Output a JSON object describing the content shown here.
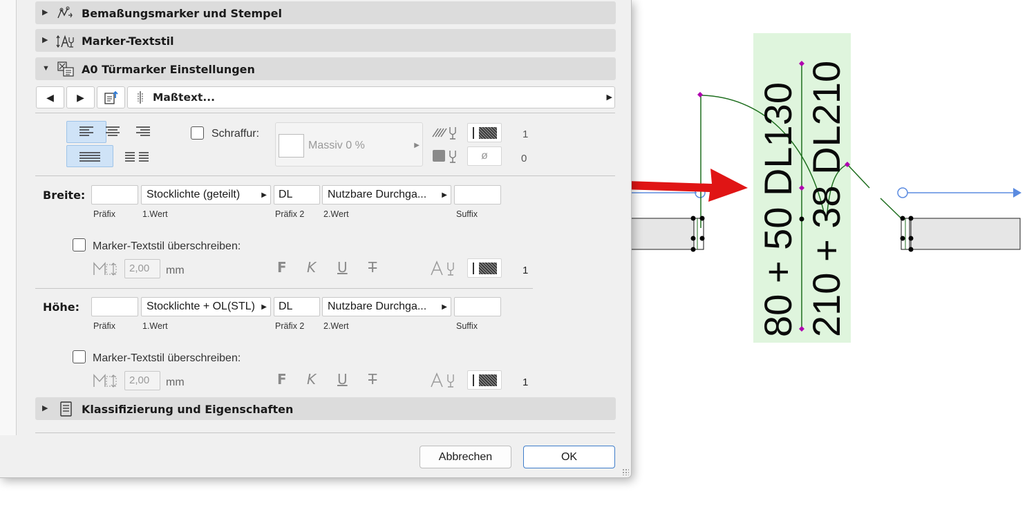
{
  "sections": {
    "dimension_markers": "Bemaßungsmarker und Stempel",
    "marker_text_style": "Marker-Textstil",
    "door_marker_settings": "A0 Türmarker Einstellungen",
    "classification": "Klassifizierung und Eigenschaften"
  },
  "nav": {
    "prev": "◀",
    "next": "▶",
    "page_title": "Maßtext...",
    "page_arrow": "▶"
  },
  "fill": {
    "label": "Schraffur:",
    "value": "Massiv 0 %",
    "pen_value": "1",
    "bg_value": "0",
    "bg_symbol": "ø"
  },
  "width": {
    "label": "Breite:",
    "prefix": "",
    "value1": "Stocklichte (geteilt)",
    "prefix2": "DL",
    "value2": "Nutzbare Durchga...",
    "suffix": "",
    "override_label": "Marker-Textstil überschreiben:",
    "size": "2,00",
    "unit": "mm",
    "pen": "1"
  },
  "height": {
    "label": "Höhe:",
    "prefix": "",
    "value1": "Stocklichte + OL(STL)",
    "prefix2": "DL",
    "value2": "Nutzbare Durchga...",
    "suffix": "",
    "override_label": "Marker-Textstil überschreiben:",
    "size": "2,00",
    "unit": "mm",
    "pen": "1"
  },
  "captions": {
    "prefix": "Präfix",
    "value1": "1.Wert",
    "prefix2": "Präfix 2",
    "value2": "2.Wert",
    "suffix": "Suffix"
  },
  "format_glyphs": {
    "bold": "F",
    "italic": "K",
    "underline": "U",
    "strike": "T"
  },
  "buttons": {
    "cancel": "Abbrechen",
    "ok": "OK"
  },
  "marker": {
    "line1": "80 + 50 DL130",
    "line2": "210 + 38 DL210",
    "highlight_color": "#dff5dd",
    "wall_color": "#1e6e1e",
    "arrow_color": "#e01515",
    "dim_color": "#5b8be0",
    "handle_color": "#b000b0"
  }
}
